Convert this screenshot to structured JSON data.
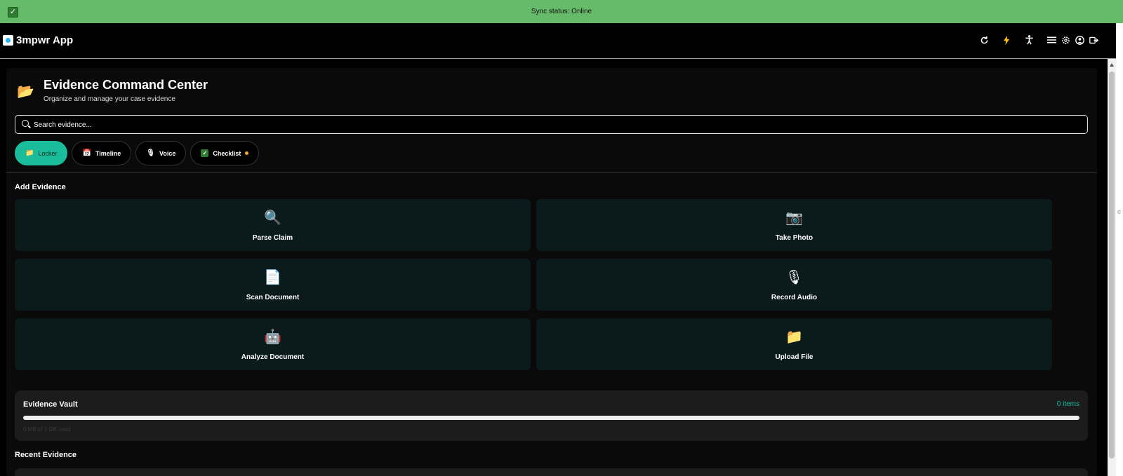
{
  "sync": {
    "status_text": "Sync status: Online"
  },
  "app": {
    "title": "3mpwr App"
  },
  "header_icons": [
    "refresh-icon",
    "bolt-icon",
    "accessibility-icon",
    "menu-icon",
    "settings-icon",
    "account-icon",
    "logout-icon"
  ],
  "page": {
    "title": "Evidence Command Center",
    "subtitle": "Organize and manage your case evidence"
  },
  "search": {
    "placeholder": "Search evidence..."
  },
  "tabs": [
    {
      "label": "Locker",
      "icon": "folder-icon",
      "active": true
    },
    {
      "label": "Timeline",
      "icon": "calendar-icon",
      "active": false
    },
    {
      "label": "Voice",
      "icon": "microphone-icon",
      "active": false
    },
    {
      "label": "Checklist",
      "icon": "checkbox-icon",
      "active": false,
      "badge": true
    }
  ],
  "add_evidence": {
    "title": "Add Evidence",
    "actions": [
      {
        "label": "Parse Claim",
        "icon": "magnifier-icon",
        "glyph": "🔍"
      },
      {
        "label": "Take Photo",
        "icon": "camera-icon",
        "glyph": "📷"
      },
      {
        "label": "Scan Document",
        "icon": "document-icon",
        "glyph": "📄"
      },
      {
        "label": "Record Audio",
        "icon": "microphone-icon",
        "glyph": "🎙"
      },
      {
        "label": "Analyze Document",
        "icon": "robot-icon",
        "glyph": "🤖"
      },
      {
        "label": "Upload File",
        "icon": "folder-icon",
        "glyph": "📁"
      }
    ]
  },
  "vault": {
    "title": "Evidence Vault",
    "count_text": "0 items",
    "usage_text": "0 MB of 1 GB used",
    "usage_fraction": 0
  },
  "recent": {
    "title": "Recent Evidence"
  },
  "colors": {
    "accent": "#1abc9c",
    "banner": "#66bb6a",
    "card": "#0b1a1a"
  }
}
